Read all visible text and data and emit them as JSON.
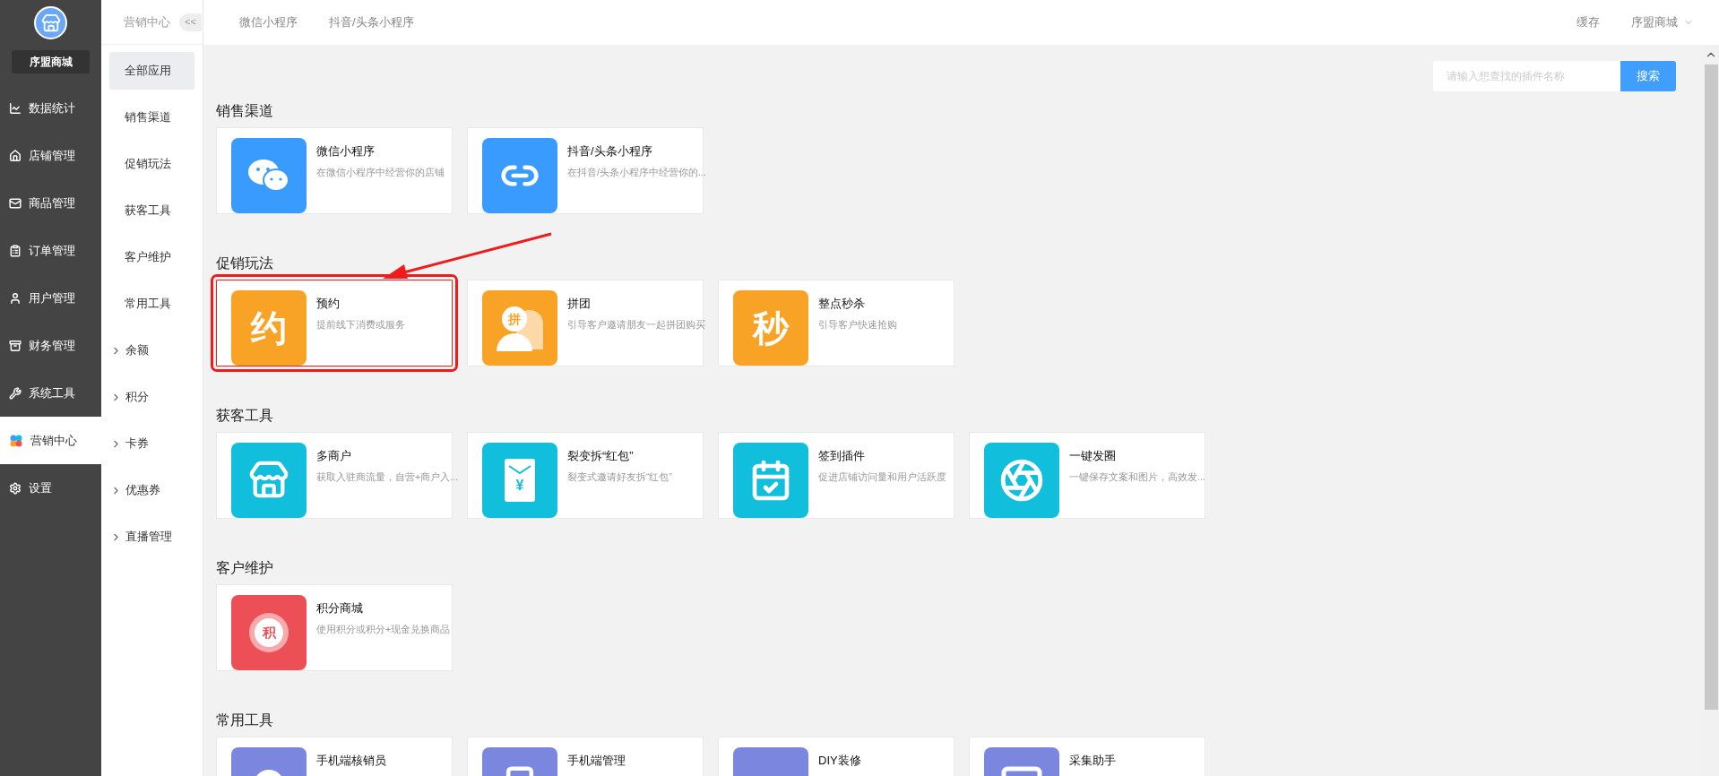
{
  "sidebar": {
    "shop_name": "序盟商城",
    "items": [
      {
        "label": "数据统计",
        "kind": "chart",
        "selected": false
      },
      {
        "label": "店铺管理",
        "kind": "store",
        "selected": false
      },
      {
        "label": "商品管理",
        "kind": "mail",
        "selected": false
      },
      {
        "label": "订单管理",
        "kind": "clipboard",
        "selected": false
      },
      {
        "label": "用户管理",
        "kind": "user",
        "selected": false
      },
      {
        "label": "财务管理",
        "kind": "finance",
        "selected": false
      },
      {
        "label": "系统工具",
        "kind": "wrench",
        "selected": false
      },
      {
        "label": "营销中心",
        "kind": "clover",
        "selected": true
      },
      {
        "label": "设置",
        "kind": "settings",
        "selected": false
      }
    ]
  },
  "subnav": {
    "title": "营销中心",
    "collapse": "<<",
    "items": [
      {
        "label": "全部应用",
        "kind": "plain",
        "selected": true
      },
      {
        "label": "销售渠道",
        "kind": "plain",
        "selected": false
      },
      {
        "label": "促销玩法",
        "kind": "plain",
        "selected": false
      },
      {
        "label": "获客工具",
        "kind": "plain",
        "selected": false
      },
      {
        "label": "客户维护",
        "kind": "plain",
        "selected": false
      },
      {
        "label": "常用工具",
        "kind": "plain",
        "selected": false
      },
      {
        "label": "余额",
        "kind": "group",
        "selected": false
      },
      {
        "label": "积分",
        "kind": "group",
        "selected": false
      },
      {
        "label": "卡券",
        "kind": "group",
        "selected": false
      },
      {
        "label": "优惠券",
        "kind": "group",
        "selected": false
      },
      {
        "label": "直播管理",
        "kind": "group",
        "selected": false
      }
    ]
  },
  "topbar": {
    "tabs": [
      "微信小程序",
      "抖音/头条小程序"
    ],
    "cache": "缓存",
    "account": "序盟商城"
  },
  "search": {
    "placeholder": "请输入想查找的插件名称",
    "button": "搜索"
  },
  "sections": [
    {
      "title": "销售渠道",
      "plugins": [
        {
          "name": "微信小程序",
          "desc": "在微信小程序中经营你的店铺",
          "kind": "wechat",
          "color": "#3a9bff",
          "highlighted": false
        },
        {
          "name": "抖音/头条小程序",
          "desc": "在抖音/头条小程序中经营你的...",
          "kind": "link",
          "color": "#3a9bff",
          "highlighted": false
        }
      ]
    },
    {
      "title": "促销玩法",
      "plugins": [
        {
          "name": "预约",
          "desc": "提前线下消费或服务",
          "kind": "glyph",
          "glyph": "约",
          "color": "#f8a325",
          "highlighted": true
        },
        {
          "name": "拼团",
          "desc": "引导客户邀请朋友一起拼团购买",
          "kind": "group",
          "glyph": "拼",
          "color": "#f8a325",
          "highlighted": false
        },
        {
          "name": "整点秒杀",
          "desc": "引导客户快速抢购",
          "kind": "glyph",
          "glyph": "秒",
          "color": "#f8a325",
          "highlighted": false
        }
      ]
    },
    {
      "title": "获客工具",
      "plugins": [
        {
          "name": "多商户",
          "desc": "获取入驻商流量，自营+商户入...",
          "kind": "shop",
          "color": "#11bedb",
          "highlighted": false
        },
        {
          "name": "裂变拆“红包”",
          "desc": "裂变式邀请好友拆“红包”",
          "kind": "envelope",
          "glyph": "¥",
          "color": "#11bedb",
          "highlighted": false
        },
        {
          "name": "签到插件",
          "desc": "促进店铺访问量和用户活跃度",
          "kind": "calendar",
          "color": "#11bedb",
          "highlighted": false
        },
        {
          "name": "一键发圈",
          "desc": "一键保存文案和图片，高效发...",
          "kind": "aperture",
          "color": "#11bedb",
          "highlighted": false
        }
      ]
    },
    {
      "title": "客户维护",
      "plugins": [
        {
          "name": "积分商城",
          "desc": "使用积分或积分+现金兑换商品",
          "kind": "coin",
          "glyph": "积",
          "color": "#ec4f56",
          "highlighted": false
        }
      ]
    },
    {
      "title": "常用工具",
      "plugins": [
        {
          "name": "手机端核销员",
          "kind": "circle",
          "color": "#7b86df",
          "highlighted": false
        },
        {
          "name": "手机端管理",
          "kind": "phone",
          "color": "#7b86df",
          "highlighted": false
        },
        {
          "name": "DIY装修",
          "kind": "blank",
          "color": "#7b86df",
          "highlighted": false
        },
        {
          "name": "采集助手",
          "kind": "frame",
          "color": "#7b86df",
          "highlighted": false
        }
      ]
    }
  ]
}
